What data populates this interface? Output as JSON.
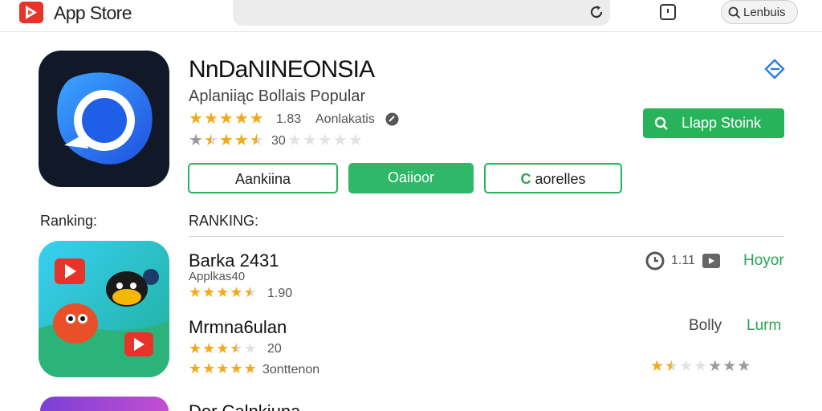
{
  "window": {
    "app_title": "App Store"
  },
  "search": {
    "label": "Lenbuis"
  },
  "featured": {
    "title": "NnDaNINEONSIA",
    "subtitle": "Aplaniiąc Bollais Popular",
    "rating_count": "1.83",
    "rating_label": "Aonlakatis",
    "secondary_count": "30",
    "search_button": "Llapp Stoink",
    "buttons": [
      "Aankiina",
      "Oaiioor",
      "aorelles"
    ]
  },
  "rankings": {
    "left_label": "Ranking:",
    "right_label": "RANKING:",
    "items": [
      {
        "title": "Barka 2431",
        "subtitle": "Applkas40",
        "rating_text": "1.90",
        "count": "1.11",
        "action": "Hoyor"
      },
      {
        "title": "Mrmna6ulan",
        "rating_text": "20",
        "rating_text_2": "3onttenon",
        "side_text": "Bolly",
        "action": "Lurm"
      },
      {
        "title": "Dor Calnkiuna"
      }
    ]
  },
  "colors": {
    "accent_green": "#27b35a",
    "star_gold": "#f2a91a",
    "link_blue": "#2a7de1"
  },
  "icons": [
    "app-store-logo-icon",
    "reload-icon",
    "bookmark-icon",
    "search-icon",
    "share-icon",
    "info-icon",
    "video-badge-icon"
  ]
}
